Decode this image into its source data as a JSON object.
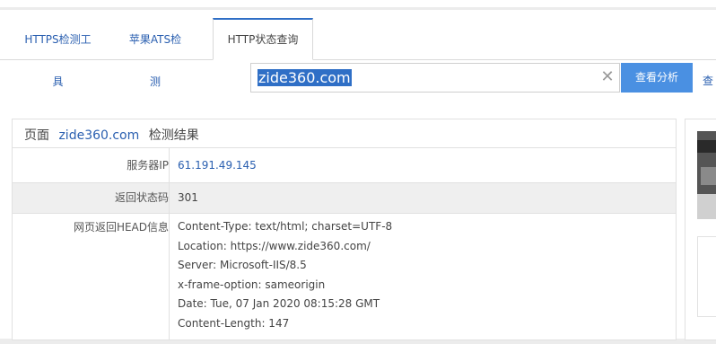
{
  "tabs": [
    {
      "label": "HTTPS检测工具"
    },
    {
      "label": "苹果ATS检测"
    },
    {
      "label": "HTTP状态查询"
    }
  ],
  "search": {
    "value": "zide360.com",
    "button_label": "查看分析",
    "side_link": "查"
  },
  "result": {
    "title_prefix": "页面",
    "domain": "zide360.com",
    "title_suffix": "检测结果",
    "rows": [
      {
        "label": "服务器IP",
        "value": "61.191.49.145"
      },
      {
        "label": "返回状态码",
        "value": "301"
      }
    ],
    "head_label": "网页返回HEAD信息",
    "head_lines": [
      "Content-Type: text/html; charset=UTF-8",
      "Location: https://www.zide360.com/",
      "Server: Microsoft-IIS/8.5",
      "x-frame-option: sameorigin",
      "Date: Tue, 07 Jan 2020 08:15:28 GMT",
      "Content-Length: 147"
    ]
  }
}
